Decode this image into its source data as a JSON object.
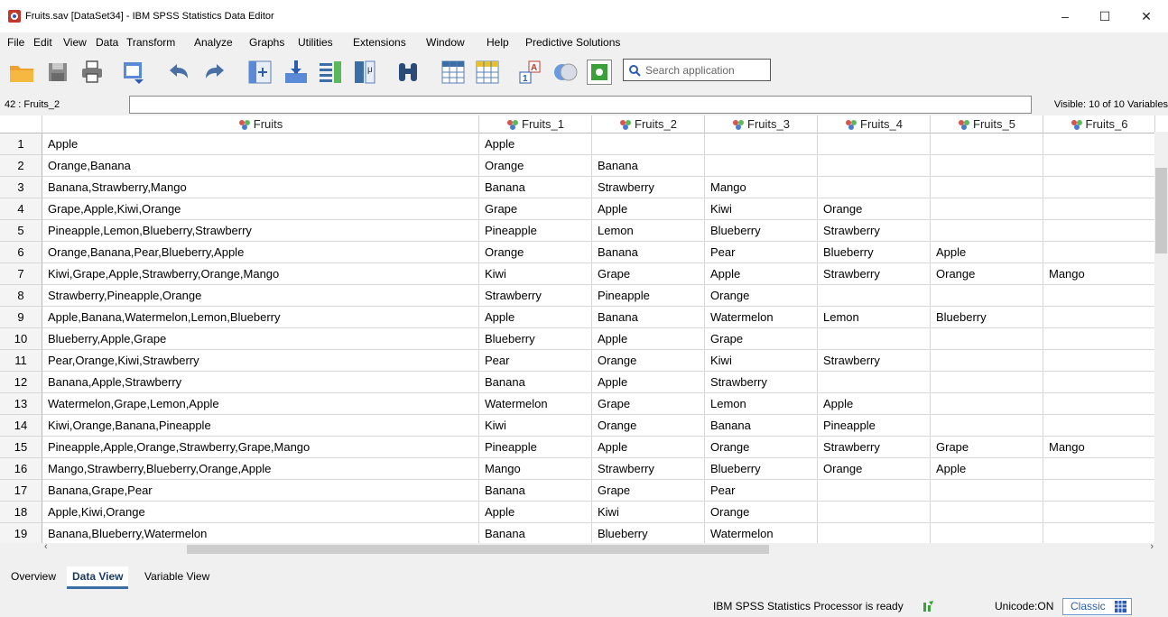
{
  "window": {
    "title": "Fruits.sav [DataSet34] - IBM SPSS Statistics Data Editor",
    "minimize": "–",
    "maximize": "☐",
    "close": "✕"
  },
  "menu": {
    "items": [
      "File",
      "Edit",
      "View",
      "Data",
      "Transform",
      "Analyze",
      "Graphs",
      "Utilities",
      "Extensions",
      "Window",
      "Help",
      "Predictive Solutions"
    ]
  },
  "toolbar": {
    "icons": [
      "open-folder",
      "save",
      "print",
      "recall-dialog",
      "undo",
      "redo",
      "goto-case",
      "goto-variable",
      "variables",
      "split-file",
      "find",
      "insert-cases",
      "insert-variable",
      "value-labels",
      "use-sets",
      "show-all"
    ],
    "search_placeholder": "Search application"
  },
  "cell_editor": {
    "reference": "42 : Fruits_2",
    "value": "",
    "visible_vars": "Visible: 10 of 10 Variables"
  },
  "grid": {
    "columns": [
      "Fruits",
      "Fruits_1",
      "Fruits_2",
      "Fruits_3",
      "Fruits_4",
      "Fruits_5",
      "Fruits_6"
    ],
    "rows": [
      {
        "n": "1",
        "cells": [
          "Apple",
          "Apple",
          "",
          "",
          "",
          "",
          ""
        ]
      },
      {
        "n": "2",
        "cells": [
          "Orange,Banana",
          "Orange",
          "Banana",
          "",
          "",
          "",
          ""
        ]
      },
      {
        "n": "3",
        "cells": [
          "Banana,Strawberry,Mango",
          "Banana",
          "Strawberry",
          "Mango",
          "",
          "",
          ""
        ]
      },
      {
        "n": "4",
        "cells": [
          "Grape,Apple,Kiwi,Orange",
          "Grape",
          "Apple",
          "Kiwi",
          "Orange",
          "",
          ""
        ]
      },
      {
        "n": "5",
        "cells": [
          "Pineapple,Lemon,Blueberry,Strawberry",
          "Pineapple",
          "Lemon",
          "Blueberry",
          "Strawberry",
          "",
          ""
        ]
      },
      {
        "n": "6",
        "cells": [
          "Orange,Banana,Pear,Blueberry,Apple",
          "Orange",
          "Banana",
          "Pear",
          "Blueberry",
          "Apple",
          ""
        ]
      },
      {
        "n": "7",
        "cells": [
          "Kiwi,Grape,Apple,Strawberry,Orange,Mango",
          "Kiwi",
          "Grape",
          "Apple",
          "Strawberry",
          "Orange",
          "Mango"
        ]
      },
      {
        "n": "8",
        "cells": [
          "Strawberry,Pineapple,Orange",
          "Strawberry",
          "Pineapple",
          "Orange",
          "",
          "",
          ""
        ]
      },
      {
        "n": "9",
        "cells": [
          "Apple,Banana,Watermelon,Lemon,Blueberry",
          "Apple",
          "Banana",
          "Watermelon",
          "Lemon",
          "Blueberry",
          ""
        ]
      },
      {
        "n": "10",
        "cells": [
          "Blueberry,Apple,Grape",
          "Blueberry",
          "Apple",
          "Grape",
          "",
          "",
          ""
        ]
      },
      {
        "n": "11",
        "cells": [
          "Pear,Orange,Kiwi,Strawberry",
          "Pear",
          "Orange",
          "Kiwi",
          "Strawberry",
          "",
          ""
        ]
      },
      {
        "n": "12",
        "cells": [
          "Banana,Apple,Strawberry",
          "Banana",
          "Apple",
          "Strawberry",
          "",
          "",
          ""
        ]
      },
      {
        "n": "13",
        "cells": [
          "Watermelon,Grape,Lemon,Apple",
          "Watermelon",
          "Grape",
          "Lemon",
          "Apple",
          "",
          ""
        ]
      },
      {
        "n": "14",
        "cells": [
          "Kiwi,Orange,Banana,Pineapple",
          "Kiwi",
          "Orange",
          "Banana",
          "Pineapple",
          "",
          ""
        ]
      },
      {
        "n": "15",
        "cells": [
          "Pineapple,Apple,Orange,Strawberry,Grape,Mango",
          "Pineapple",
          "Apple",
          "Orange",
          "Strawberry",
          "Grape",
          "Mango"
        ]
      },
      {
        "n": "16",
        "cells": [
          "Mango,Strawberry,Blueberry,Orange,Apple",
          "Mango",
          "Strawberry",
          "Blueberry",
          "Orange",
          "Apple",
          ""
        ]
      },
      {
        "n": "17",
        "cells": [
          "Banana,Grape,Pear",
          "Banana",
          "Grape",
          "Pear",
          "",
          "",
          ""
        ]
      },
      {
        "n": "18",
        "cells": [
          "Apple,Kiwi,Orange",
          "Apple",
          "Kiwi",
          "Orange",
          "",
          "",
          ""
        ]
      },
      {
        "n": "19",
        "cells": [
          "Banana,Blueberry,Watermelon",
          "Banana",
          "Blueberry",
          "Watermelon",
          "",
          "",
          ""
        ]
      }
    ]
  },
  "tabs": {
    "overview": "Overview",
    "data_view": "Data View",
    "variable_view": "Variable View"
  },
  "status": {
    "processor": "IBM SPSS Statistics Processor is ready",
    "unicode": "Unicode:ON",
    "classic": "Classic"
  },
  "colors": {
    "accent": "#2a5db0",
    "nominal_icon_red": "#d9534f",
    "nominal_icon_green": "#5cb85c",
    "nominal_icon_blue": "#4a7bd0"
  }
}
